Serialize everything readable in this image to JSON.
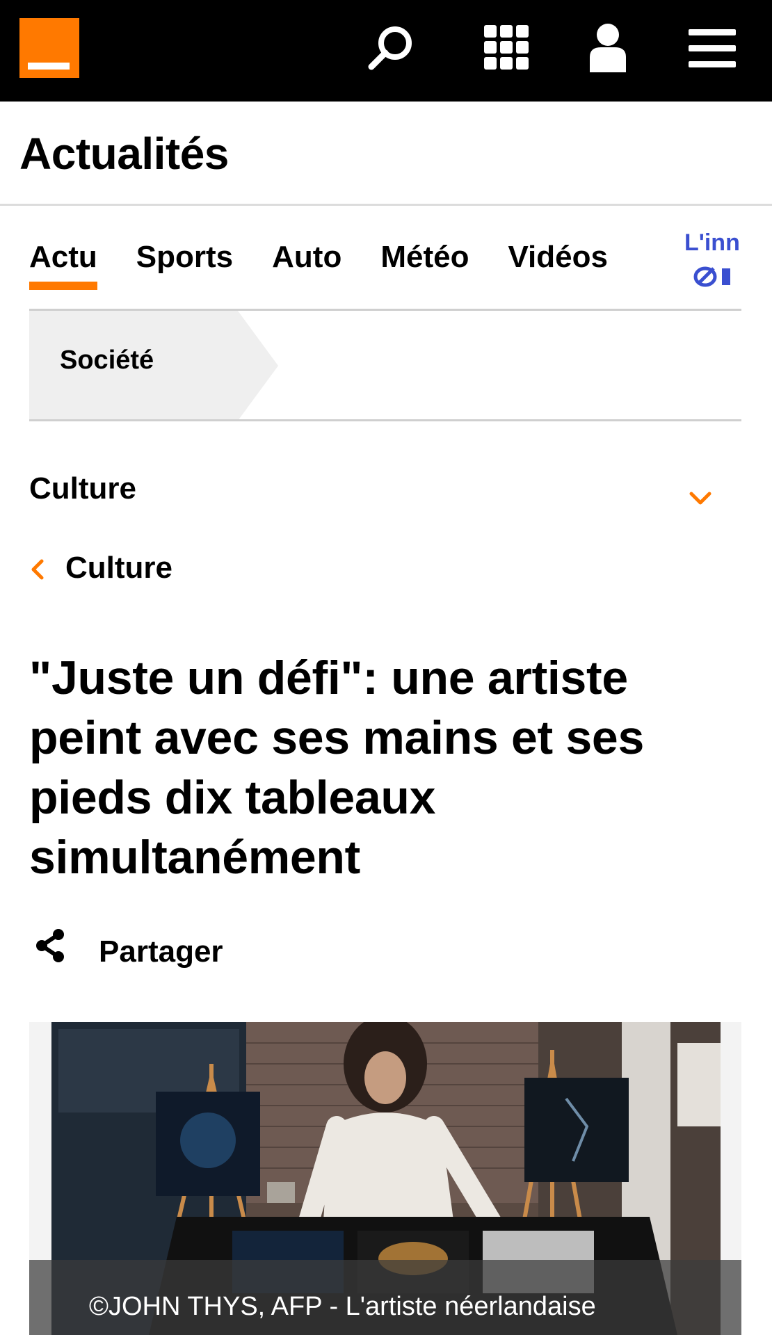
{
  "header": {
    "brand_color": "#ff7900",
    "icons": [
      "orange-logo",
      "search-icon",
      "apps-grid-icon",
      "user-icon",
      "menu-icon"
    ]
  },
  "section": {
    "title": "Actualités"
  },
  "tabs": [
    {
      "label": "Actu",
      "active": true
    },
    {
      "label": "Sports"
    },
    {
      "label": "Auto"
    },
    {
      "label": "Météo"
    },
    {
      "label": "Vidéos"
    }
  ],
  "promo": {
    "text": "L'inn",
    "color": "#3a4fd0"
  },
  "breadcrumb": {
    "label": "Société"
  },
  "category_dropdown": {
    "label": "Culture"
  },
  "back_link": {
    "label": "Culture"
  },
  "article": {
    "title": "\"Juste un défi\": une artiste peint avec ses mains et ses pieds dix tableaux simultanément",
    "share_label": "Partager",
    "image_caption": "©JOHN THYS, AFP - L'artiste néerlandaise"
  }
}
